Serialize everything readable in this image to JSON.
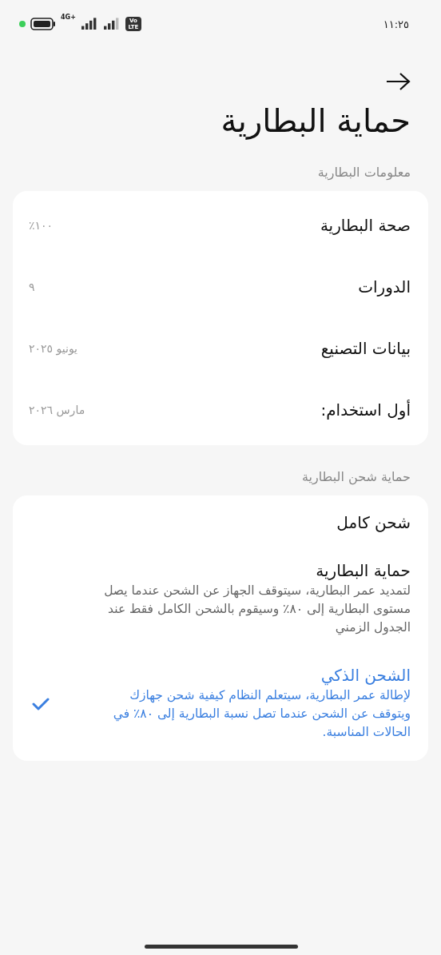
{
  "status_bar": {
    "time": "١١:٢٥",
    "network": "4G+",
    "volte": "Vo LTE"
  },
  "page_title": "حماية البطارية",
  "info_section": {
    "label": "معلومات البطارية",
    "rows": [
      {
        "label": "صحة البطارية",
        "value": "١٠٠٪"
      },
      {
        "label": "الدورات",
        "value": "٩"
      },
      {
        "label": "بيانات التصنيع",
        "value": "يونيو ٢٠٢٥"
      },
      {
        "label": "أول استخدام:",
        "value": "مارس ٢٠٢٦"
      }
    ]
  },
  "charging_section": {
    "label": "حماية شحن البطارية",
    "options": [
      {
        "title": "شحن كامل",
        "selected": false
      },
      {
        "title": "حماية البطارية",
        "description": "لتمديد عمر البطارية، سيتوقف الجهاز عن الشحن عندما يصل مستوى البطارية إلى ٨٠٪ وسيقوم بالشحن الكامل فقط عند الجدول الزمني",
        "selected": false
      },
      {
        "title": "الشحن الذكي",
        "description": "لإطالة عمر البطارية، سيتعلم النظام كيفية شحن جهازك ويتوقف عن الشحن عندما تصل نسبة البطارية إلى ٨٠٪ في الحالات المناسبة.",
        "selected": true
      }
    ]
  }
}
